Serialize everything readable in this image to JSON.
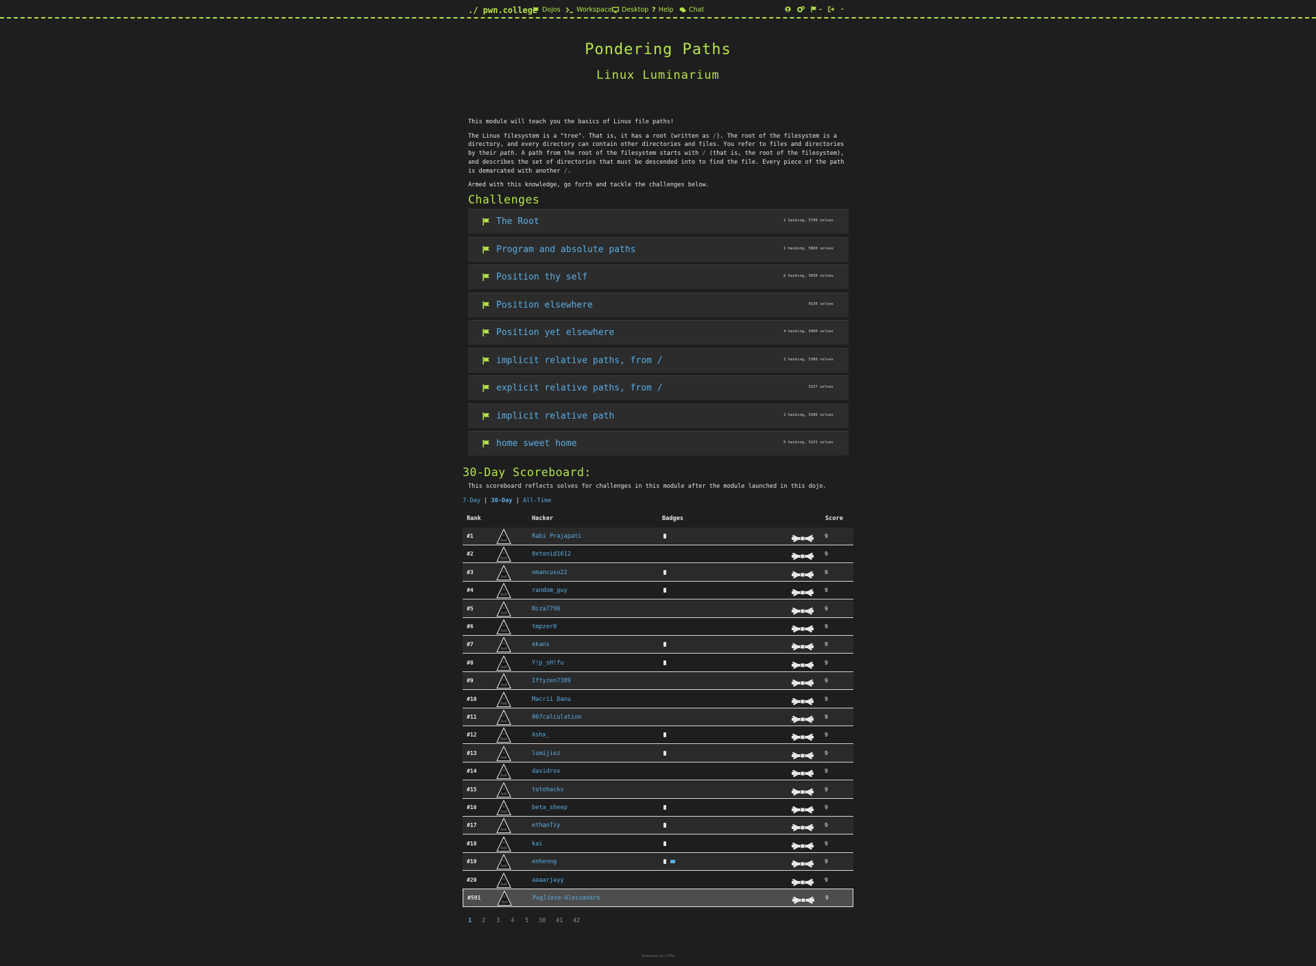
{
  "brand": "./ pwn.college",
  "nav": {
    "dojos": "Dojos",
    "workspace": "Workspace",
    "desktop": "Desktop",
    "help": "Help",
    "chat": "Chat"
  },
  "module": {
    "title": "Pondering Paths",
    "dojo": "Linux Luminarium"
  },
  "description": {
    "p1": "This module will teach you the basics of Linux file paths!",
    "p2_a": "The Linux filesystem is a \"tree\". That is, it has a root (written as ",
    "p2_code1": "/",
    "p2_b": "). The root of the filesystem is a directory, and every directory can contain other directories and files. You refer to files and directories by their ",
    "p2_em": "path",
    "p2_c": ". A path from the root of the filesystem starts with ",
    "p2_code2": "/",
    "p2_d": " (that is, the root of the filesystem), and describes the set of directories that must be descended into to find the file. Every piece of the path is demarcated with another ",
    "p2_code3": "/",
    "p2_e": ".",
    "p3": "Armed with this knowledge, go forth and tackle the challenges below."
  },
  "challenges_heading": "Challenges",
  "challenges": [
    {
      "name": "The Root",
      "solves": "1 hacking, 5798 solves"
    },
    {
      "name": "Program and absolute paths",
      "solves": "1 hacking, 5800 solves"
    },
    {
      "name": "Position thy self",
      "solves": "6 hacking, 5650 solves"
    },
    {
      "name": "Position elsewhere",
      "solves": "5530 solves"
    },
    {
      "name": "Position yet elsewhere",
      "solves": "4 hacking, 5460 solves"
    },
    {
      "name": "implicit relative paths, from /",
      "solves": "1 hacking, 5380 solves"
    },
    {
      "name": "explicit relative paths, from /",
      "solves": "5317 solves"
    },
    {
      "name": "implicit relative path",
      "solves": "1 hacking, 5200 solves"
    },
    {
      "name": "home sweet home",
      "solves": "5 hacking, 5101 solves"
    }
  ],
  "scoreboard": {
    "heading": "30-Day Scoreboard:",
    "description": "This scoreboard reflects solves for challenges in this module after the module launched in this dojo.",
    "tabs": {
      "day7": "7-Day",
      "sep": " | ",
      "day30": "30-Day",
      "all": "All-Time"
    },
    "columns": {
      "rank": "Rank",
      "hacker": "Hacker",
      "badges": "Badges",
      "score": "Score"
    },
    "rows": [
      {
        "rank": "#1",
        "hacker": "Rabi Prajapati",
        "badges": 1,
        "score": "9"
      },
      {
        "rank": "#2",
        "hacker": "0xtonid1612",
        "badges": 0,
        "score": "9"
      },
      {
        "rank": "#3",
        "hacker": "nmancuso22",
        "badges": 1,
        "score": "9"
      },
      {
        "rank": "#4",
        "hacker": "random_guy",
        "badges": 1,
        "score": "9"
      },
      {
        "rank": "#5",
        "hacker": "Niza7796",
        "badges": 0,
        "score": "9"
      },
      {
        "rank": "#6",
        "hacker": "tmpzer0",
        "badges": 0,
        "score": "9"
      },
      {
        "rank": "#7",
        "hacker": "ekans",
        "badges": 1,
        "score": "9"
      },
      {
        "rank": "#8",
        "hacker": "Y!p_sH!fu",
        "badges": 1,
        "score": "9"
      },
      {
        "rank": "#9",
        "hacker": "Iftyzen7389",
        "badges": 0,
        "score": "9"
      },
      {
        "rank": "#10",
        "hacker": "Macrii Danu",
        "badges": 0,
        "score": "9"
      },
      {
        "rank": "#11",
        "hacker": "007calculation",
        "badges": 0,
        "score": "9"
      },
      {
        "rank": "#12",
        "hacker": "Ashx_",
        "badges": 1,
        "score": "9"
      },
      {
        "rank": "#13",
        "hacker": "lumijiez",
        "badges": 1,
        "score": "9"
      },
      {
        "rank": "#14",
        "hacker": "davidrox",
        "badges": 0,
        "score": "9"
      },
      {
        "rank": "#15",
        "hacker": "totohacks",
        "badges": 0,
        "score": "9"
      },
      {
        "rank": "#16",
        "hacker": "beta_sheep",
        "badges": 1,
        "score": "9"
      },
      {
        "rank": "#17",
        "hacker": "ethanTzy",
        "badges": 1,
        "score": "9"
      },
      {
        "rank": "#18",
        "hacker": "kai",
        "badges": 1,
        "score": "9"
      },
      {
        "rank": "#19",
        "hacker": "enhenng",
        "badges": 2,
        "score": "9"
      },
      {
        "rank": "#20",
        "hacker": "aaaarjayy",
        "badges": 0,
        "score": "9"
      }
    ],
    "current_user": {
      "rank": "#591",
      "hacker": "Pugliese-Alessandro",
      "badges": 0,
      "score": "9"
    }
  },
  "pagination": [
    "1",
    "2",
    "3",
    "4",
    "5",
    "30",
    "41",
    "42"
  ],
  "footer": "Powered by CTFd",
  "colors": {
    "accent_green": "#b6e34a",
    "link_blue": "#5aaee6",
    "background": "#1e1e1e"
  }
}
